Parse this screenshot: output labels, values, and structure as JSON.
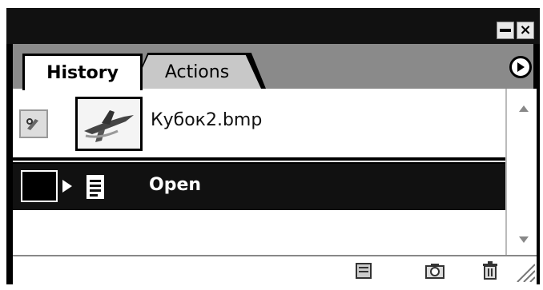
{
  "window": {
    "minimize_label": "minimize",
    "close_label": "×"
  },
  "tabs": [
    {
      "label": "History",
      "active": true
    },
    {
      "label": "Actions",
      "active": false
    }
  ],
  "panel_menu_icon": "play-arrow-icon",
  "snapshot": {
    "name": "Кубок2.bmp",
    "source_icon": "history-brush-icon",
    "thumbnail_icon": "airplane-thumbnail"
  },
  "history_states": [
    {
      "label": "Open",
      "icon": "document-icon",
      "selected": true
    }
  ],
  "bottom_toolbar": {
    "new_document_icon": "new-document-icon",
    "new_snapshot_icon": "camera-icon",
    "delete_icon": "trash-icon"
  },
  "colors": {
    "selected_row": "#111111",
    "tab_strip": "#8a8a8a"
  }
}
